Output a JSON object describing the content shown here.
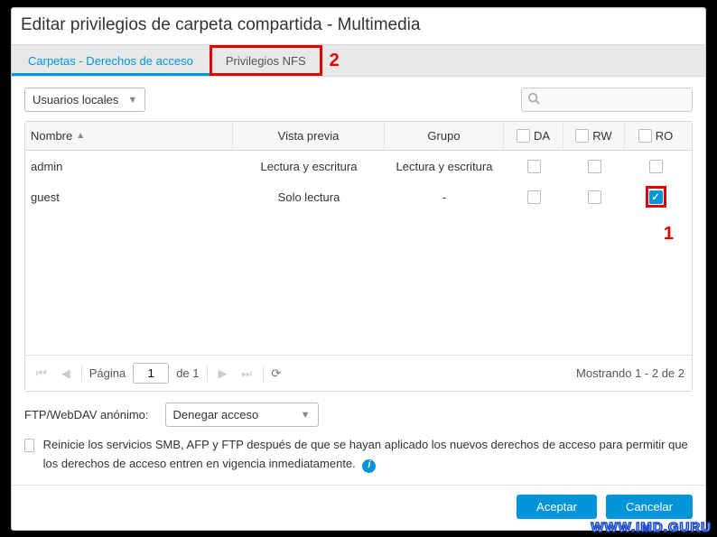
{
  "title": "Editar privilegios de carpeta compartida - Multimedia",
  "tabs": {
    "access": "Carpetas - Derechos de acceso",
    "nfs": "Privilegios NFS"
  },
  "filter_select": "Usuarios locales",
  "search_placeholder": "",
  "columns": {
    "name": "Nombre",
    "preview": "Vista previa",
    "group": "Grupo",
    "da": "DA",
    "rw": "RW",
    "ro": "RO"
  },
  "rows": [
    {
      "name": "admin",
      "preview": "Lectura y escritura",
      "group": "Lectura y escritura",
      "da": false,
      "rw": false,
      "ro": false
    },
    {
      "name": "guest",
      "preview": "Solo lectura",
      "group": "-",
      "da": false,
      "rw": false,
      "ro": true
    }
  ],
  "pager": {
    "page_label": "Página",
    "page": "1",
    "of_label": "de 1",
    "showing": "Mostrando 1 - 2 de 2"
  },
  "ftp_label": "FTP/WebDAV anónimo:",
  "ftp_value": "Denegar acceso",
  "restart_note": "Reinicie los servicios SMB, AFP y FTP después de que se hayan aplicado los nuevos derechos de acceso para permitir que los derechos de acceso entren en vigencia inmediatamente.",
  "buttons": {
    "ok": "Aceptar",
    "cancel": "Cancelar"
  },
  "annotations": {
    "a1": "1",
    "a2": "2"
  },
  "watermark": "WWW.IMD.GURU"
}
